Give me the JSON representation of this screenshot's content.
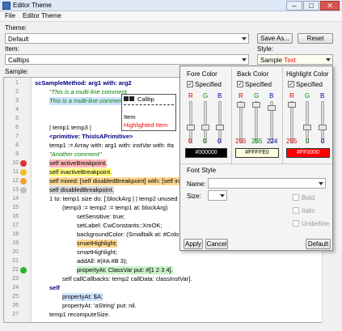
{
  "window": {
    "title": "Editor Theme",
    "minimize": "–",
    "maximize": "□",
    "close": "✕"
  },
  "menu": {
    "file": "File",
    "editor_theme": "Editor Theme"
  },
  "theme": {
    "label": "Theme:",
    "value": "Default",
    "save_as": "Save As...",
    "reset": "Reset"
  },
  "item": {
    "label": "Item:",
    "value": "Calltips"
  },
  "style": {
    "label": "Style:",
    "value_a": "Sample ",
    "value_b": "Text"
  },
  "sample": {
    "label": "Sample:"
  },
  "code_lines": [
    {
      "n": "1",
      "t": "scSampleMethod: arg1 with: arg2"
    },
    {
      "n": "2",
      "t": "\"This is a multi-line comment"
    },
    {
      "n": "3",
      "t": "This is a multi-line comment"
    },
    {
      "n": "4",
      "t": ""
    },
    {
      "n": "5",
      "t": ""
    },
    {
      "n": "6",
      "t": "| temp1 temp3 |"
    },
    {
      "n": "7",
      "t": "<primitive: ThisIsAPrimitive>"
    },
    {
      "n": "8",
      "t": "temp1 := Array with: arg1 with: instVar with: #a"
    },
    {
      "n": "9",
      "t": "\"Another comment\""
    },
    {
      "n": "10",
      "t": "self activeBreakpoint."
    },
    {
      "n": "11",
      "t": "self inactiveBreakpoint."
    },
    {
      "n": "12",
      "t": "self mixed: [self disabledBreakpoint] with: [self ina"
    },
    {
      "n": "13",
      "t": "self disabledBreakpoint."
    },
    {
      "n": "14",
      "t": "1 to: temp1 size do: [:blockArg | | temp2 unused"
    },
    {
      "n": "15",
      "t": "(temp3 := temp2 := temp1 at: blockArg)"
    },
    {
      "n": "16",
      "t": "setSensitive: true;"
    },
    {
      "n": "17",
      "t": "setLabel: CwConstants::XmOK;"
    },
    {
      "n": "18",
      "t": "backgroundColor: (Smalltalk at: #Colo"
    },
    {
      "n": "19",
      "t": "smartHighlight;"
    },
    {
      "n": "20",
      "t": "smartHighlight;"
    },
    {
      "n": "21",
      "t": "addAll: #(#A #B 3);"
    },
    {
      "n": "22",
      "t": "propertyAt: ClassVar put: #[1 2 3 4]."
    },
    {
      "n": "23",
      "t": "self callCallbacks: temp2 callData: classInstVar]."
    },
    {
      "n": "24",
      "t": "self"
    },
    {
      "n": "25",
      "t": "propertyAt: $A;"
    },
    {
      "n": "26",
      "t": "propertyAt: 'aString' put: nil."
    },
    {
      "n": "27",
      "t": "temp1 recomputeSize."
    }
  ],
  "calltip": {
    "title": "Calltip",
    "item": "Item",
    "highlighted": "Highlighted Item"
  },
  "panel": {
    "fore_color": "Fore Color",
    "back_color": "Back Color",
    "highlight_color": "Highlight Color",
    "specified": "Specified",
    "r": "R",
    "g": "G",
    "b": "B",
    "fore_vals": [
      "0",
      "0",
      "0"
    ],
    "back_vals": [
      "255",
      "255",
      "224"
    ],
    "hl_vals": [
      "255",
      "0",
      "0"
    ],
    "fore_hex": "#000000",
    "back_hex": "#FFFFE0",
    "hl_hex": "#FF0000",
    "font_style": "Font Style",
    "name": "Name:",
    "size": "Size:",
    "bold": "Bold",
    "italic": "Italic",
    "underline": "Underline",
    "apply": "Apply",
    "cancel": "Cancel",
    "default": "Default"
  },
  "colors": {
    "accent": "#3b6fb6",
    "back_swatch": "#FFFFE0",
    "hl_swatch": "#FF0000",
    "fore_swatch": "#000000"
  }
}
